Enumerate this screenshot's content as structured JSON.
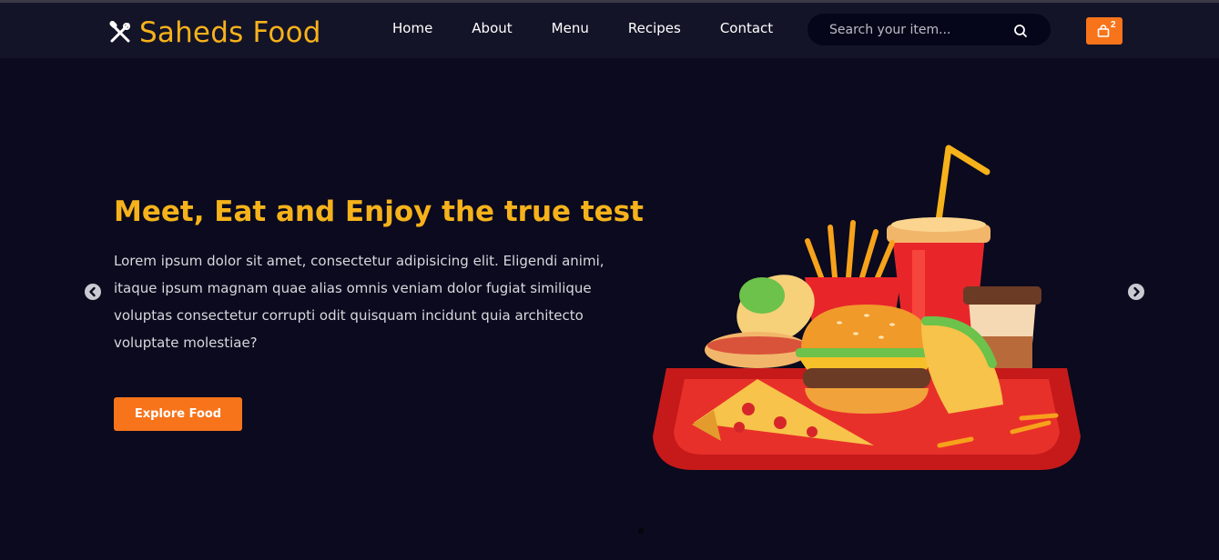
{
  "brand": {
    "name": "Saheds Food",
    "icon": "fork-knife-icon",
    "color": "#f6b21b"
  },
  "nav": {
    "items": [
      {
        "label": "Home"
      },
      {
        "label": "About"
      },
      {
        "label": "Menu"
      },
      {
        "label": "Recipes"
      },
      {
        "label": "Contact"
      }
    ]
  },
  "search": {
    "placeholder": "Search your item...",
    "value": "",
    "icon": "search-icon"
  },
  "cart": {
    "count": "2",
    "icon": "shopping-bag-icon",
    "color": "#f7741b"
  },
  "hero": {
    "title": "Meet, Eat and Enjoy the true test",
    "description": "Lorem ipsum dolor sit amet, consectetur adipisicing elit. Eligendi animi, itaque ipsum magnam quae alias omnis veniam dolor fugiat similique voluptas consectetur corrupti odit quisquam incidunt quia architecto voluptate molestiae?",
    "button_label": "Explore Food"
  },
  "carousel": {
    "prev_icon": "chevron-left-icon",
    "next_icon": "chevron-right-icon",
    "image": "fast-food-tray-illustration"
  },
  "colors": {
    "background": "#0b0a1e",
    "navbar": "#141428",
    "accent": "#f7741b",
    "title": "#f6b21b"
  }
}
